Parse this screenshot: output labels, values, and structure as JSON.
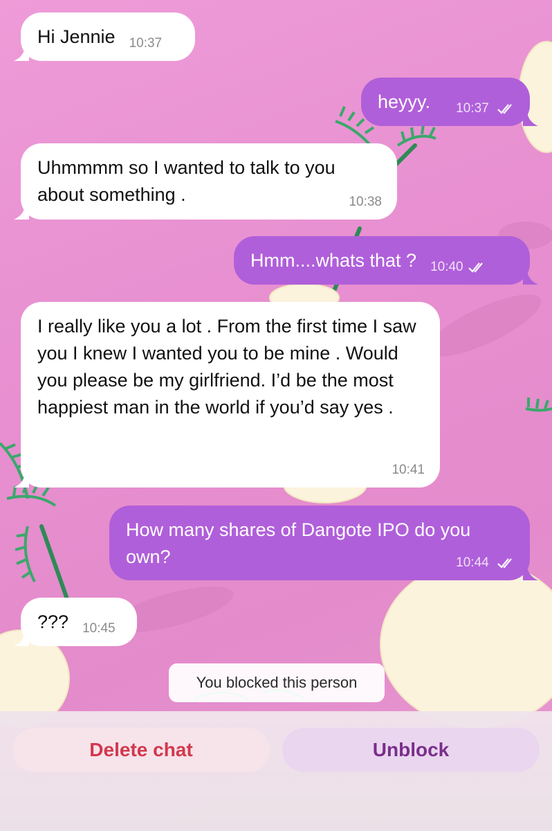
{
  "messages": [
    {
      "direction": "incoming",
      "text": "Hi Jennie",
      "time": "10:37"
    },
    {
      "direction": "outgoing",
      "text": "heyyy.",
      "time": "10:37",
      "status": "read-double-check-icon"
    },
    {
      "direction": "incoming",
      "text": "Uhmmmm so I wanted to talk to you about something .",
      "time": "10:38"
    },
    {
      "direction": "outgoing",
      "text": "Hmm....whats that ?",
      "time": "10:40",
      "status": "read-double-check-icon"
    },
    {
      "direction": "incoming",
      "text": "I really like you a lot . From the first time I saw you I knew I wanted you to be mine . Would you please be my girlfriend. I’d be the most happiest man in the world if you’d say yes .",
      "time": "10:41"
    },
    {
      "direction": "outgoing",
      "text": "How many shares of Dangote IPO do you own?",
      "time": "10:44",
      "status": "read-double-check-icon"
    },
    {
      "direction": "incoming",
      "text": "???",
      "time": "10:45"
    }
  ],
  "system_note": "You blocked this person",
  "actions": {
    "delete_label": "Delete chat",
    "unblock_label": "Unblock"
  },
  "colors": {
    "incoming_bubble": "#ffffff",
    "outgoing_bubble": "#b05fda",
    "wallpaper": "#e78fd0",
    "delete_text": "#d2384e",
    "unblock_text": "#7a2e8c"
  }
}
